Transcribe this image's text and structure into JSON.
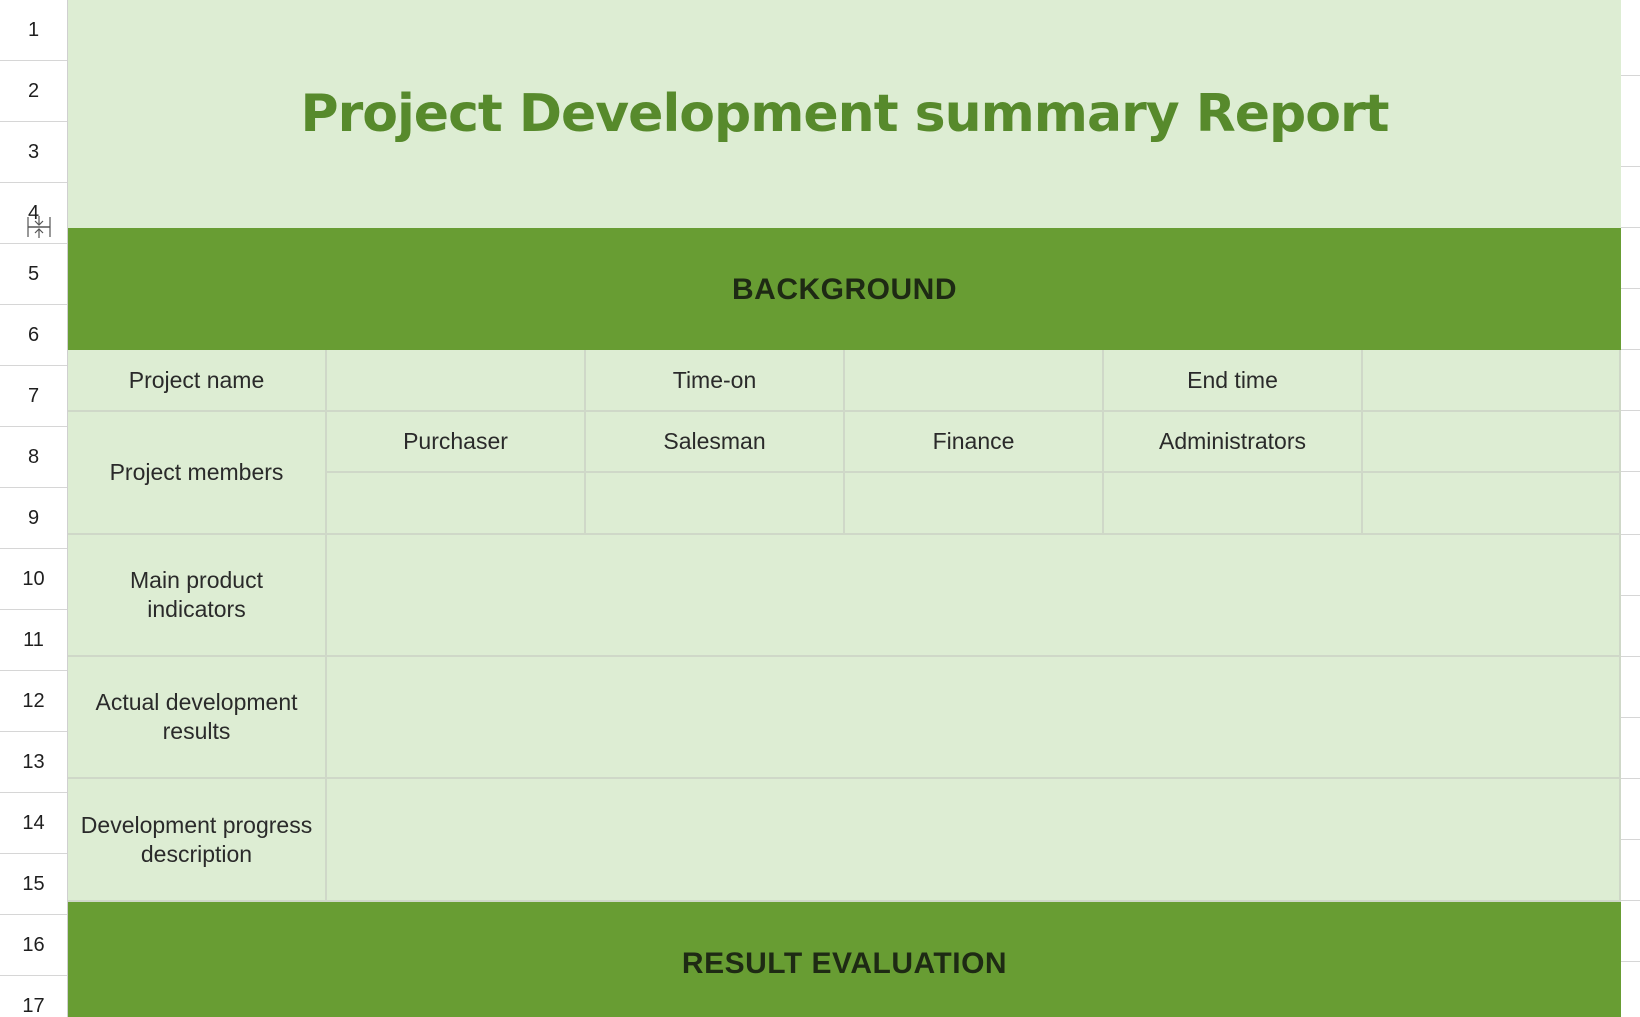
{
  "rows": [
    "1",
    "2",
    "3",
    "4",
    "5",
    "6",
    "7",
    "8",
    "9",
    "10",
    "11",
    "12",
    "13",
    "14",
    "15",
    "16",
    "17"
  ],
  "title": "Project Development summary Report",
  "sections": {
    "background": "BACKGROUND",
    "result_evaluation": "RESULT EVALUATION"
  },
  "fields": {
    "project_name_label": "Project name",
    "project_name_value": "",
    "time_on_label": "Time-on",
    "time_on_value": "",
    "end_time_label": "End time",
    "end_time_value": "",
    "project_members_label": "Project members",
    "members": [
      "Purchaser",
      "Salesman",
      "Finance",
      "Administrators",
      ""
    ],
    "member_values": [
      "",
      "",
      "",
      "",
      ""
    ],
    "main_product_indicators_label": "Main product indicators",
    "main_product_indicators_value": "",
    "actual_development_results_label": "Actual development results",
    "actual_development_results_value": "",
    "development_progress_description_label": "Development progress description",
    "development_progress_description_value": ""
  },
  "colors": {
    "light_fill": "#ddedd3",
    "dark_fill": "#689d33",
    "title_color": "#578a2c",
    "grid_line": "#cfd8c8"
  },
  "icons": {
    "row_resize": "row-resize-icon"
  }
}
